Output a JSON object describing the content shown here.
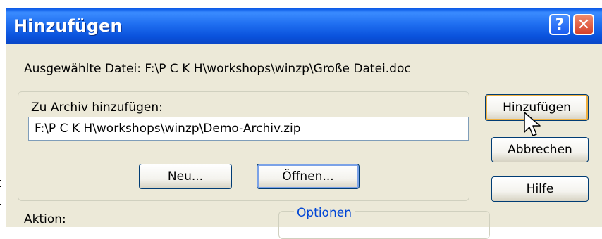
{
  "window": {
    "title": "Hinzufügen",
    "help_glyph": "?",
    "close_glyph": "✕"
  },
  "selected_file": {
    "text": "Ausgewählte Datei: F:\\P C K H\\workshops\\winzp\\Große Datei.doc"
  },
  "archive_group": {
    "label": "Zu Archiv hinzufügen:",
    "path_value": "F:\\P C K H\\workshops\\winzp\\Demo-Archiv.zip",
    "new_button": "Neu...",
    "open_button": "Öffnen..."
  },
  "side_buttons": {
    "add": "Hinzufügen",
    "cancel": "Abbrechen",
    "help": "Hilfe"
  },
  "action": {
    "label": "Aktion:"
  },
  "options": {
    "label": "Optionen"
  },
  "colors": {
    "titlebar": "#0a52dc",
    "close": "#d6402a",
    "face": "#ece9d8",
    "options_label": "#0046d5"
  },
  "icons": {
    "help": "question-mark-icon",
    "close": "close-x-icon",
    "cursor": "mouse-pointer-icon"
  }
}
